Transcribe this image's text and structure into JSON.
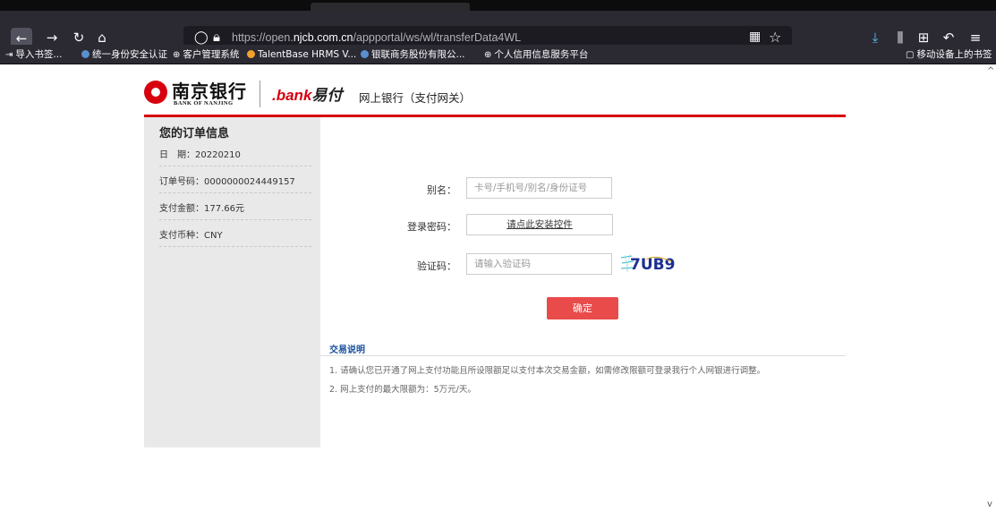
{
  "browser": {
    "url_prefix": "https://open.",
    "url_domain": "njcb.com.cn",
    "url_path": "/appportal/ws/wl/transferData4WL",
    "icons": [
      "back-arrow-icon",
      "forward-arrow-icon",
      "reload-icon",
      "home-icon",
      "shield-icon",
      "lock-icon",
      "qr-code-icon",
      "star-icon",
      "download-icon",
      "library-icon",
      "extensions-icon",
      "undo-icon",
      "menu-icon"
    ]
  },
  "bookmarks": {
    "import": "导入书签...",
    "items": [
      "统一身份安全认证",
      "客户管理系统",
      "TalentBase HRMS V...",
      "银联商务股份有限公...",
      "个人信用信息服务平台"
    ],
    "mobile": "移动设备上的书签"
  },
  "header": {
    "logo_cn": "南京银行",
    "logo_en": "BANK OF NANJING",
    "ebank_e": ".bank",
    "ebank_suffix": "易付",
    "title": "网上银行（支付网关）"
  },
  "order": {
    "title": "您的订单信息",
    "date_label": "日　期：",
    "date_value": "20220210",
    "order_no_label": "订单号码：",
    "order_no_value": "0000000024449157",
    "amount_label": "支付金额：",
    "amount_value": "177.66元",
    "currency_label": "支付币种：",
    "currency_value": "CNY"
  },
  "form": {
    "alias_label": "别名：",
    "alias_placeholder": "卡号/手机号/别名/身份证号",
    "password_label": "登录密码：",
    "install_link": "请点此安装控件",
    "captcha_label": "验证码：",
    "captcha_placeholder": "请输入验证码",
    "captcha_text": "7UB9",
    "confirm": "确定"
  },
  "transaction": {
    "title": "交易说明",
    "note1": "1. 请确认您已开通了网上支付功能且所设限额足以支付本次交易金额，如需修改限额可登录我行个人网银进行调整。",
    "note2": "2. 网上支付的最大限额为：5万元/天。"
  },
  "colors": {
    "brand_red": "#d7000f",
    "button_red": "#e94b4b",
    "link_blue": "#1a4f9e",
    "sidebar_bg": "#e9e9e9"
  }
}
